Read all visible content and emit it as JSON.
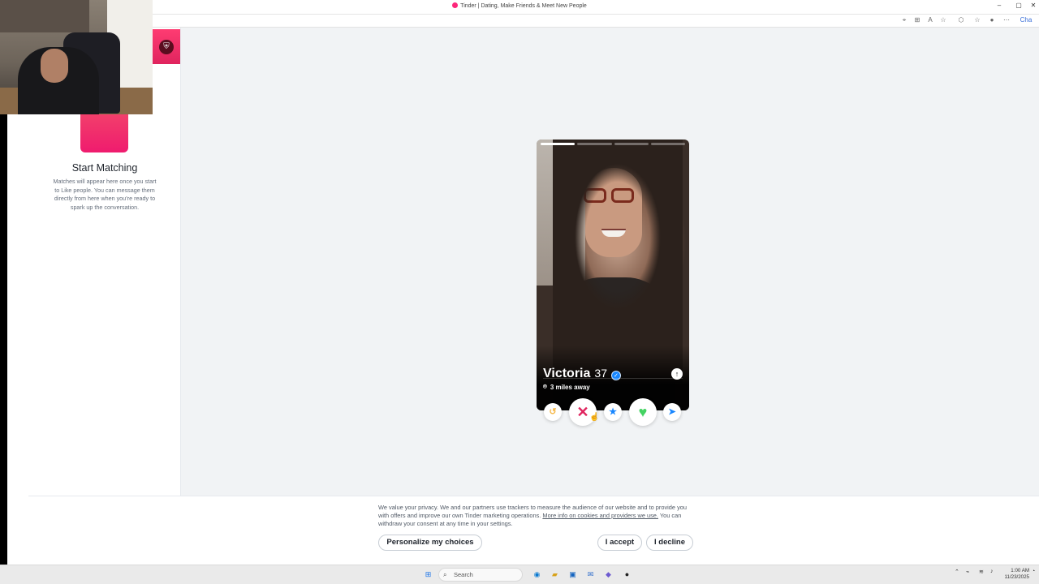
{
  "browser": {
    "tab_title": "Tinder | Dating, Make Friends & Meet New People",
    "minimize": "–",
    "maximize": "▢",
    "close": "✕",
    "profile_label": "Cha"
  },
  "sidebar": {
    "start_title": "Start Matching",
    "start_description": "Matches will appear here once you start to Like people. You can message them directly from here when you’re ready to spark up the conversation."
  },
  "card": {
    "name": "Victoria",
    "age": "37",
    "distance": "3 miles away",
    "photo_count": 4,
    "active_photo_index": 0
  },
  "actions": {
    "rewind_icon": "rewind-icon",
    "nope_icon": "close-icon",
    "superlike_icon": "star-icon",
    "like_icon": "heart-icon",
    "boost_icon": "send-icon"
  },
  "cookie": {
    "text_before": "We value your privacy. We and our partners use trackers to measure the audience of our website and to provide you with offers and improve our own Tinder marketing operations.",
    "link_text": "More info on cookies and providers we use.",
    "text_after": "You can withdraw your consent at any time in your settings.",
    "personalize_label": "Personalize my choices",
    "accept_label": "I accept",
    "decline_label": "I decline"
  },
  "taskbar": {
    "search_placeholder": "Search",
    "time": "1:00 AM",
    "date": "11/23/2025"
  },
  "colors": {
    "brand_gradient_start": "#fe3c72",
    "brand_gradient_end": "#e0245e",
    "like_green": "#44d362",
    "superlike_blue": "#1786ff",
    "rewind_gold": "#f5b748"
  }
}
